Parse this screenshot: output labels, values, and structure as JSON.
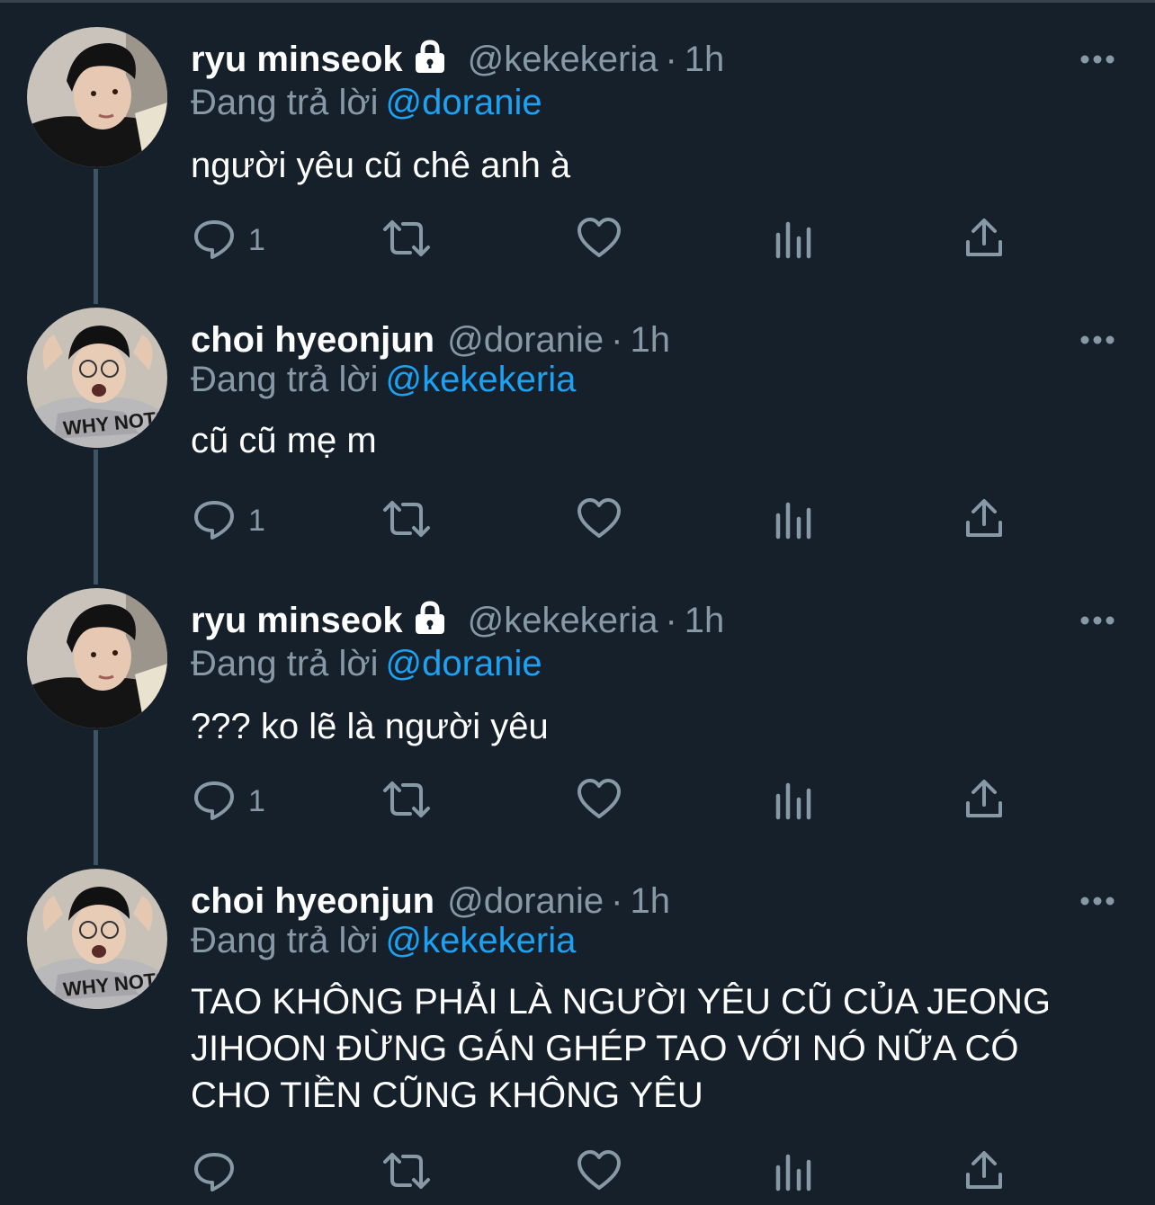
{
  "tweets": [
    {
      "name": "ryu minseok",
      "locked": true,
      "handle": "@kekekeria",
      "separator": "·",
      "time": "1h",
      "reply_prefix": "Đang trả lời",
      "reply_to": "@doranie",
      "text": "người yêu cũ chê anh à",
      "reply_count": "1"
    },
    {
      "name": "choi hyeonjun",
      "locked": false,
      "handle": "@doranie",
      "separator": "·",
      "time": "1h",
      "reply_prefix": "Đang trả lời",
      "reply_to": "@kekekeria",
      "text": "cũ cũ mẹ m",
      "reply_count": "1"
    },
    {
      "name": "ryu minseok",
      "locked": true,
      "handle": "@kekekeria",
      "separator": "·",
      "time": "1h",
      "reply_prefix": "Đang trả lời",
      "reply_to": "@doranie",
      "text": "??? ko lẽ là người yêu",
      "reply_count": "1"
    },
    {
      "name": "choi hyeonjun",
      "locked": false,
      "handle": "@doranie",
      "separator": "·",
      "time": "1h",
      "reply_prefix": "Đang trả lời",
      "reply_to": "@kekekeria",
      "text": "TAO KHÔNG PHẢI LÀ NGƯỜI YÊU CŨ CỦA JEONG JIHOON ĐỪNG GÁN GHÉP TAO VỚI NÓ NỮA CÓ CHO TIỀN CŨNG KHÔNG YÊU",
      "reply_count": ""
    }
  ],
  "avatar_shirt_text": "WHY NOT?!",
  "colors": {
    "background": "#15202b",
    "secondary_text": "#8899a6",
    "link": "#1da1f2",
    "thread_line": "#3d5466"
  }
}
